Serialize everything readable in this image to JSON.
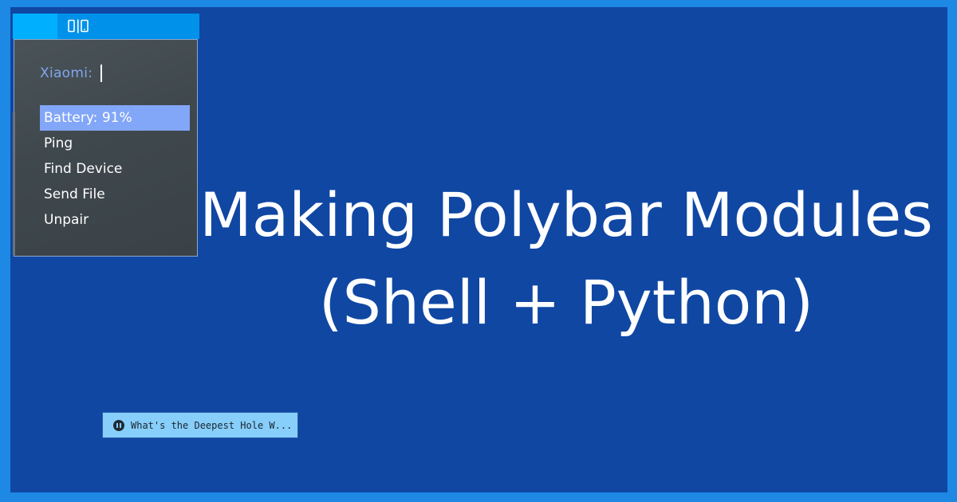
{
  "bar": {
    "module_icon": "mobile-devices-icon"
  },
  "menu": {
    "prompt": "Xiaomi:",
    "items": [
      {
        "label": "Battery: 91%",
        "selected": true
      },
      {
        "label": "Ping"
      },
      {
        "label": "Find Device"
      },
      {
        "label": "Send File"
      },
      {
        "label": "Unpair"
      }
    ]
  },
  "title": {
    "line1": "Making Polybar Modules",
    "line2": "(Shell + Python)"
  },
  "player": {
    "icon": "pause-icon",
    "track": "What's the Deepest Hole W..."
  },
  "colors": {
    "background": "#0f47a3",
    "frame": "#1e88e5",
    "bar": "#0091ea",
    "bar_accent": "#00b0ff",
    "menu_highlight": "#82a6f8",
    "player": "#87cefa"
  }
}
